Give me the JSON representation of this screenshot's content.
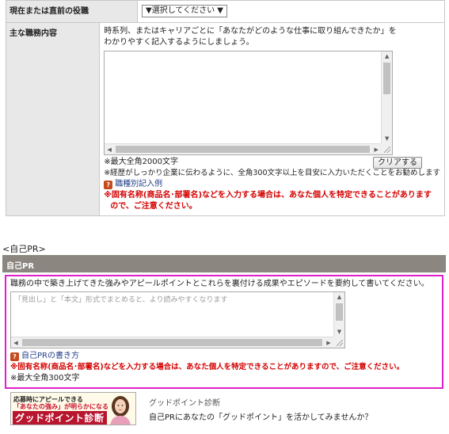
{
  "top_table": {
    "role_label": "現在または直前の役職",
    "role_select_value": "▼選択してください ▼",
    "duties_label": "主な職務内容",
    "duties_desc_1": "時系列、またはキャリアごとに「あなたがどのような仕事に取り組んできたか」を",
    "duties_desc_2": "わかりやすく記入するようにしましょう。",
    "max_chars": "※最大全角2000文字",
    "clear_button": "クリアする",
    "recommend": "※経歴がしっかり企業に伝わるように、全角300文字以上を目安に入力いただくことをお勧めします",
    "example_link": "職種別記入例",
    "warning_1": "※固有名称(商品名･部署名)などを入力する場合は、あなた個人を特定できることがありま",
    "warning_2": "す",
    "warning_3": "ので、ご注意ください。"
  },
  "pr": {
    "heading": "<自己PR>",
    "bar_title": "自己PR",
    "instruction": "職務の中で築き上げてきた強みやアピールポイントとこれらを裏付ける成果やエピソードを要約して書いてください。",
    "placeholder": "「見出し」と「本文」形式でまとめると、より読みやすくなります",
    "howto_link": "自己PRの書き方",
    "warning": "※固有名称(商品名･部署名)などを入力する場合は、あなた個人を特定できることがありますので、ご注意ください。",
    "max_chars": "※最大全角300文字"
  },
  "banner": {
    "line1": "応募時にアピールできる",
    "line2": "「あなたの強み」が明らかになる",
    "line3": "グッドポイント診断"
  },
  "good_point": {
    "title": "グッドポイント診断",
    "text": "自己PRにあなたの「グッドポイント」を活かしてみませんか？"
  },
  "icons": {
    "question": "question-icon",
    "scroll_up": "arrow-up-icon",
    "scroll_down": "arrow-down-icon",
    "scroll_left": "arrow-left-icon",
    "scroll_right": "arrow-right-icon"
  },
  "colors": {
    "warning": "#d40000",
    "highlight_border": "#e020c8",
    "section_bar": "#8b8680",
    "link": "#223f8a"
  }
}
